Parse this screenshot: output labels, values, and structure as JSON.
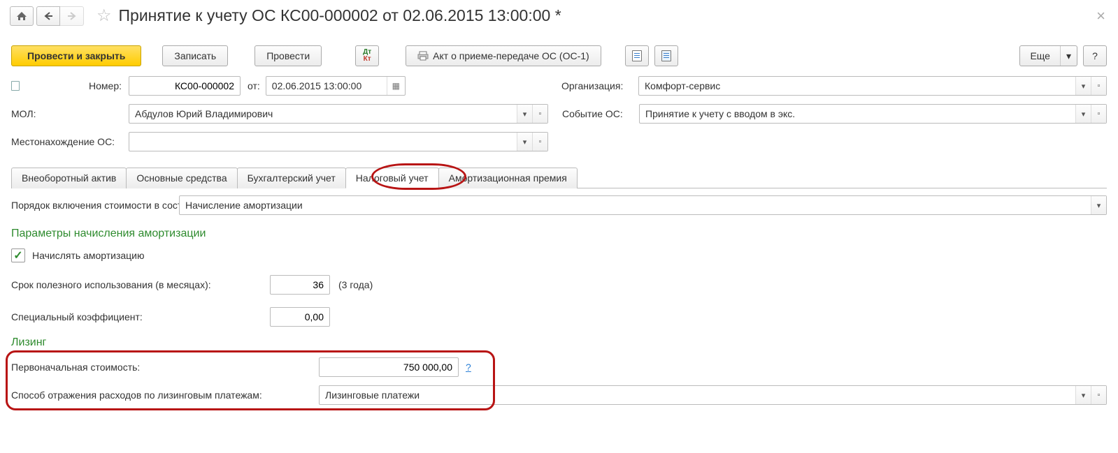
{
  "header": {
    "title": "Принятие к учету ОС КС00-000002 от 02.06.2015 13:00:00 *"
  },
  "toolbar": {
    "post_close": "Провести и закрыть",
    "save": "Записать",
    "post": "Провести",
    "print_act": "Акт о приеме-передаче ОС (ОС-1)",
    "more": "Еще",
    "help": "?"
  },
  "fields": {
    "number_label": "Номер:",
    "number_value": "КС00-000002",
    "from_label": "от:",
    "date_value": "02.06.2015 13:00:00",
    "org_label": "Организация:",
    "org_value": "Комфорт-сервис",
    "mol_label": "МОЛ:",
    "mol_value": "Абдулов Юрий Владимирович",
    "event_label": "Событие ОС:",
    "event_value": "Принятие к учету с вводом в экс.",
    "location_label": "Местонахождение ОС:",
    "location_value": ""
  },
  "tabs": [
    "Внеоборотный актив",
    "Основные средства",
    "Бухгалтерский учет",
    "Налоговый учет",
    "Амортизационная премия"
  ],
  "active_tab_index": 3,
  "tab4": {
    "order_label": "Порядок включения стоимости в состав расходов:",
    "order_value": "Начисление амортизации",
    "amort_section": "Параметры начисления амортизации",
    "charge_label": "Начислять амортизацию",
    "useful_life_label": "Срок полезного использования (в месяцах):",
    "useful_life_value": "36",
    "useful_life_years": "(3 года)",
    "coeff_label": "Специальный коэффициент:",
    "coeff_value": "0,00",
    "leasing_section": "Лизинг",
    "initial_cost_label": "Первоначальная стоимость:",
    "initial_cost_value": "750 000,00",
    "method_label": "Способ отражения расходов по лизинговым платежам:",
    "method_value": "Лизинговые платежи",
    "help_q": "?"
  }
}
